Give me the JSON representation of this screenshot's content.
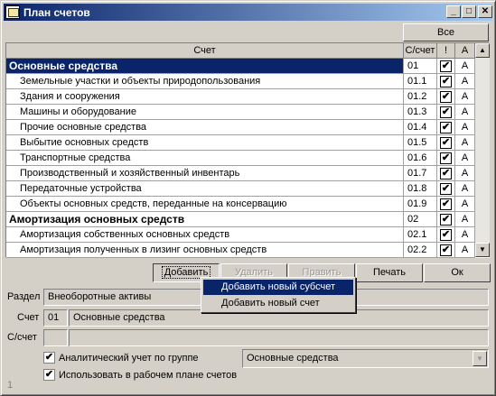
{
  "window": {
    "title": "План счетов"
  },
  "title_buttons": {
    "minimize": "_",
    "maximize": "□",
    "close": "✕"
  },
  "grid": {
    "all_button": "Все",
    "headers": {
      "name": "Счет",
      "code": "С/счет",
      "mark": "!",
      "a": "А"
    },
    "rows": [
      {
        "name": "Основные средства",
        "code": "01",
        "checked": "✔",
        "a": "А"
      },
      {
        "name": "Земельные участки  и объекты природопользования",
        "code": "01.1",
        "checked": "✔",
        "a": "А"
      },
      {
        "name": "Здания и сооружения",
        "code": "01.2",
        "checked": "✔",
        "a": "А"
      },
      {
        "name": "Машины и оборудование",
        "code": "01.3",
        "checked": "✔",
        "a": "А"
      },
      {
        "name": "Прочие основные средства",
        "code": "01.4",
        "checked": "✔",
        "a": "А"
      },
      {
        "name": "Выбытие основных средств",
        "code": "01.5",
        "checked": "✔",
        "a": "А"
      },
      {
        "name": "Транспортные средства",
        "code": "01.6",
        "checked": "✔",
        "a": "А"
      },
      {
        "name": "Производственный и хозяйственный инвентарь",
        "code": "01.7",
        "checked": "✔",
        "a": "А"
      },
      {
        "name": "Передаточные устройства",
        "code": "01.8",
        "checked": "✔",
        "a": "А"
      },
      {
        "name": "Объекты основных средств, переданные на консервацию",
        "code": "01.9",
        "checked": "✔",
        "a": "А"
      },
      {
        "name": "Амортизация основных средств",
        "code": "02",
        "checked": "✔",
        "a": "А"
      },
      {
        "name": "Амортизация собственных основных средств",
        "code": "02.1",
        "checked": "✔",
        "a": "А"
      },
      {
        "name": "Амортизация полученных в лизинг основных средств",
        "code": "02.2",
        "checked": "✔",
        "a": "А"
      }
    ]
  },
  "scroll": {
    "up": "▲",
    "down": "▼"
  },
  "buttons": {
    "add": "Добавить",
    "delete": "Удалить",
    "edit": "Править",
    "print": "Печать",
    "ok": "Ок"
  },
  "popup_menu": {
    "items": [
      "Добавить новый субсчет",
      "Добавить новый счет"
    ]
  },
  "details": {
    "section_label": "Раздел",
    "section_value": "Внеоборотные активы",
    "account_label": "Счет",
    "account_code": "01",
    "account_name": "Основные средства",
    "subaccount_label": "С/счет",
    "subaccount_code": "",
    "subaccount_name": ""
  },
  "options": {
    "analytic_label": "Аналитический учет по группе",
    "analytic_checked": "✔",
    "analytic_group": "Основные средства",
    "combo_arrow": "▼",
    "use_in_plan_label": "Использовать в рабочем плане счетов",
    "use_in_plan_checked": "✔"
  },
  "footer": {
    "status": "1"
  }
}
